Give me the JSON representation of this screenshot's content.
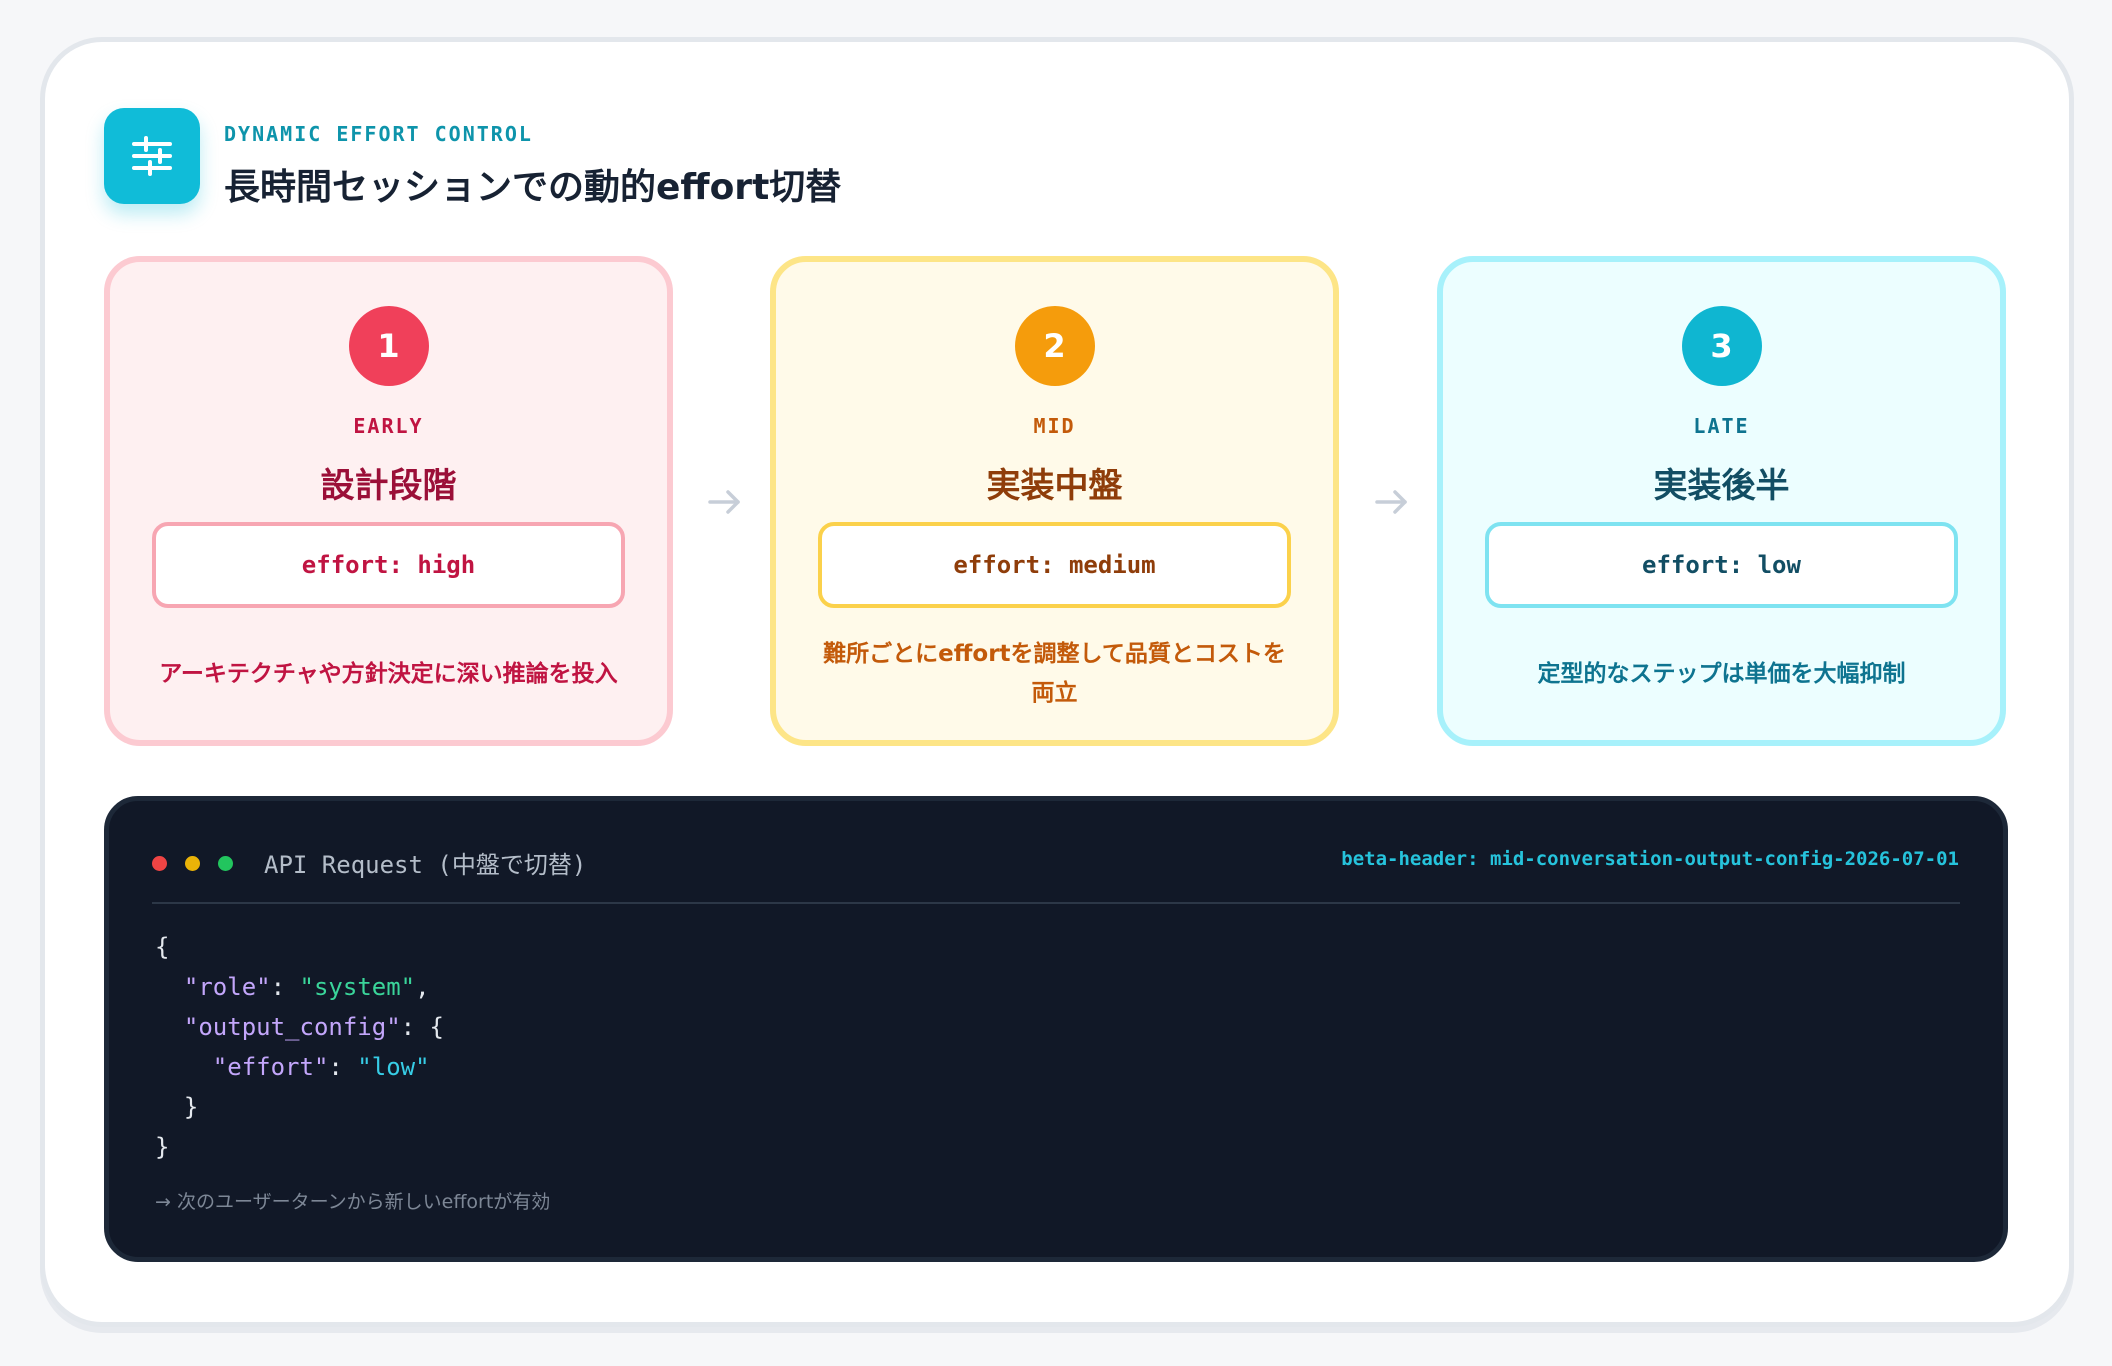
{
  "header": {
    "icon": "sliders-icon",
    "eyebrow": "DYNAMIC EFFORT CONTROL",
    "title": "長時間セッションでの動的effort切替"
  },
  "stages": [
    {
      "number": "1",
      "phase": "EARLY",
      "name": "設計段階",
      "effort": "effort: high",
      "description": "アーキテクチャや方針決定に深い推論を投入",
      "accent": "#f0405a"
    },
    {
      "number": "2",
      "phase": "MID",
      "name": "実装中盤",
      "effort": "effort: medium",
      "description": "難所ごとにeffortを調整して品質とコストを両立",
      "accent": "#f59c0c"
    },
    {
      "number": "3",
      "phase": "LATE",
      "name": "実装後半",
      "effort": "effort: low",
      "description": "定型的なステップは単価を大幅抑制",
      "accent": "#0fb6d1"
    }
  ],
  "flow_arrow_icon": "arrow-right-icon",
  "code_panel": {
    "title": "API Request (中盤で切替)",
    "beta_header": "beta-header: mid-conversation-output-config-2026-07-01",
    "dot_colors": [
      "#ef4444",
      "#eab308",
      "#22c55e"
    ],
    "code": {
      "open_brace": "{",
      "role_key": "\"role\"",
      "role_value": "\"system\"",
      "output_config_key": "\"output_config\"",
      "effort_key": "\"effort\"",
      "effort_value": "\"low\""
    },
    "note": "→ 次のユーザーターンから新しいeffortが有効"
  }
}
